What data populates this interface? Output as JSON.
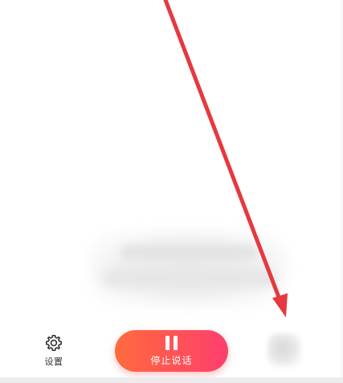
{
  "bottom_bar": {
    "settings_label": "设置",
    "settings_icon": "gear-icon",
    "stop_label": "停止说话",
    "stop_icon": "pause-icon"
  },
  "colors": {
    "accent_start": "#ff6a3d",
    "accent_end": "#ff3f6e",
    "arrow": "#e5393f"
  }
}
